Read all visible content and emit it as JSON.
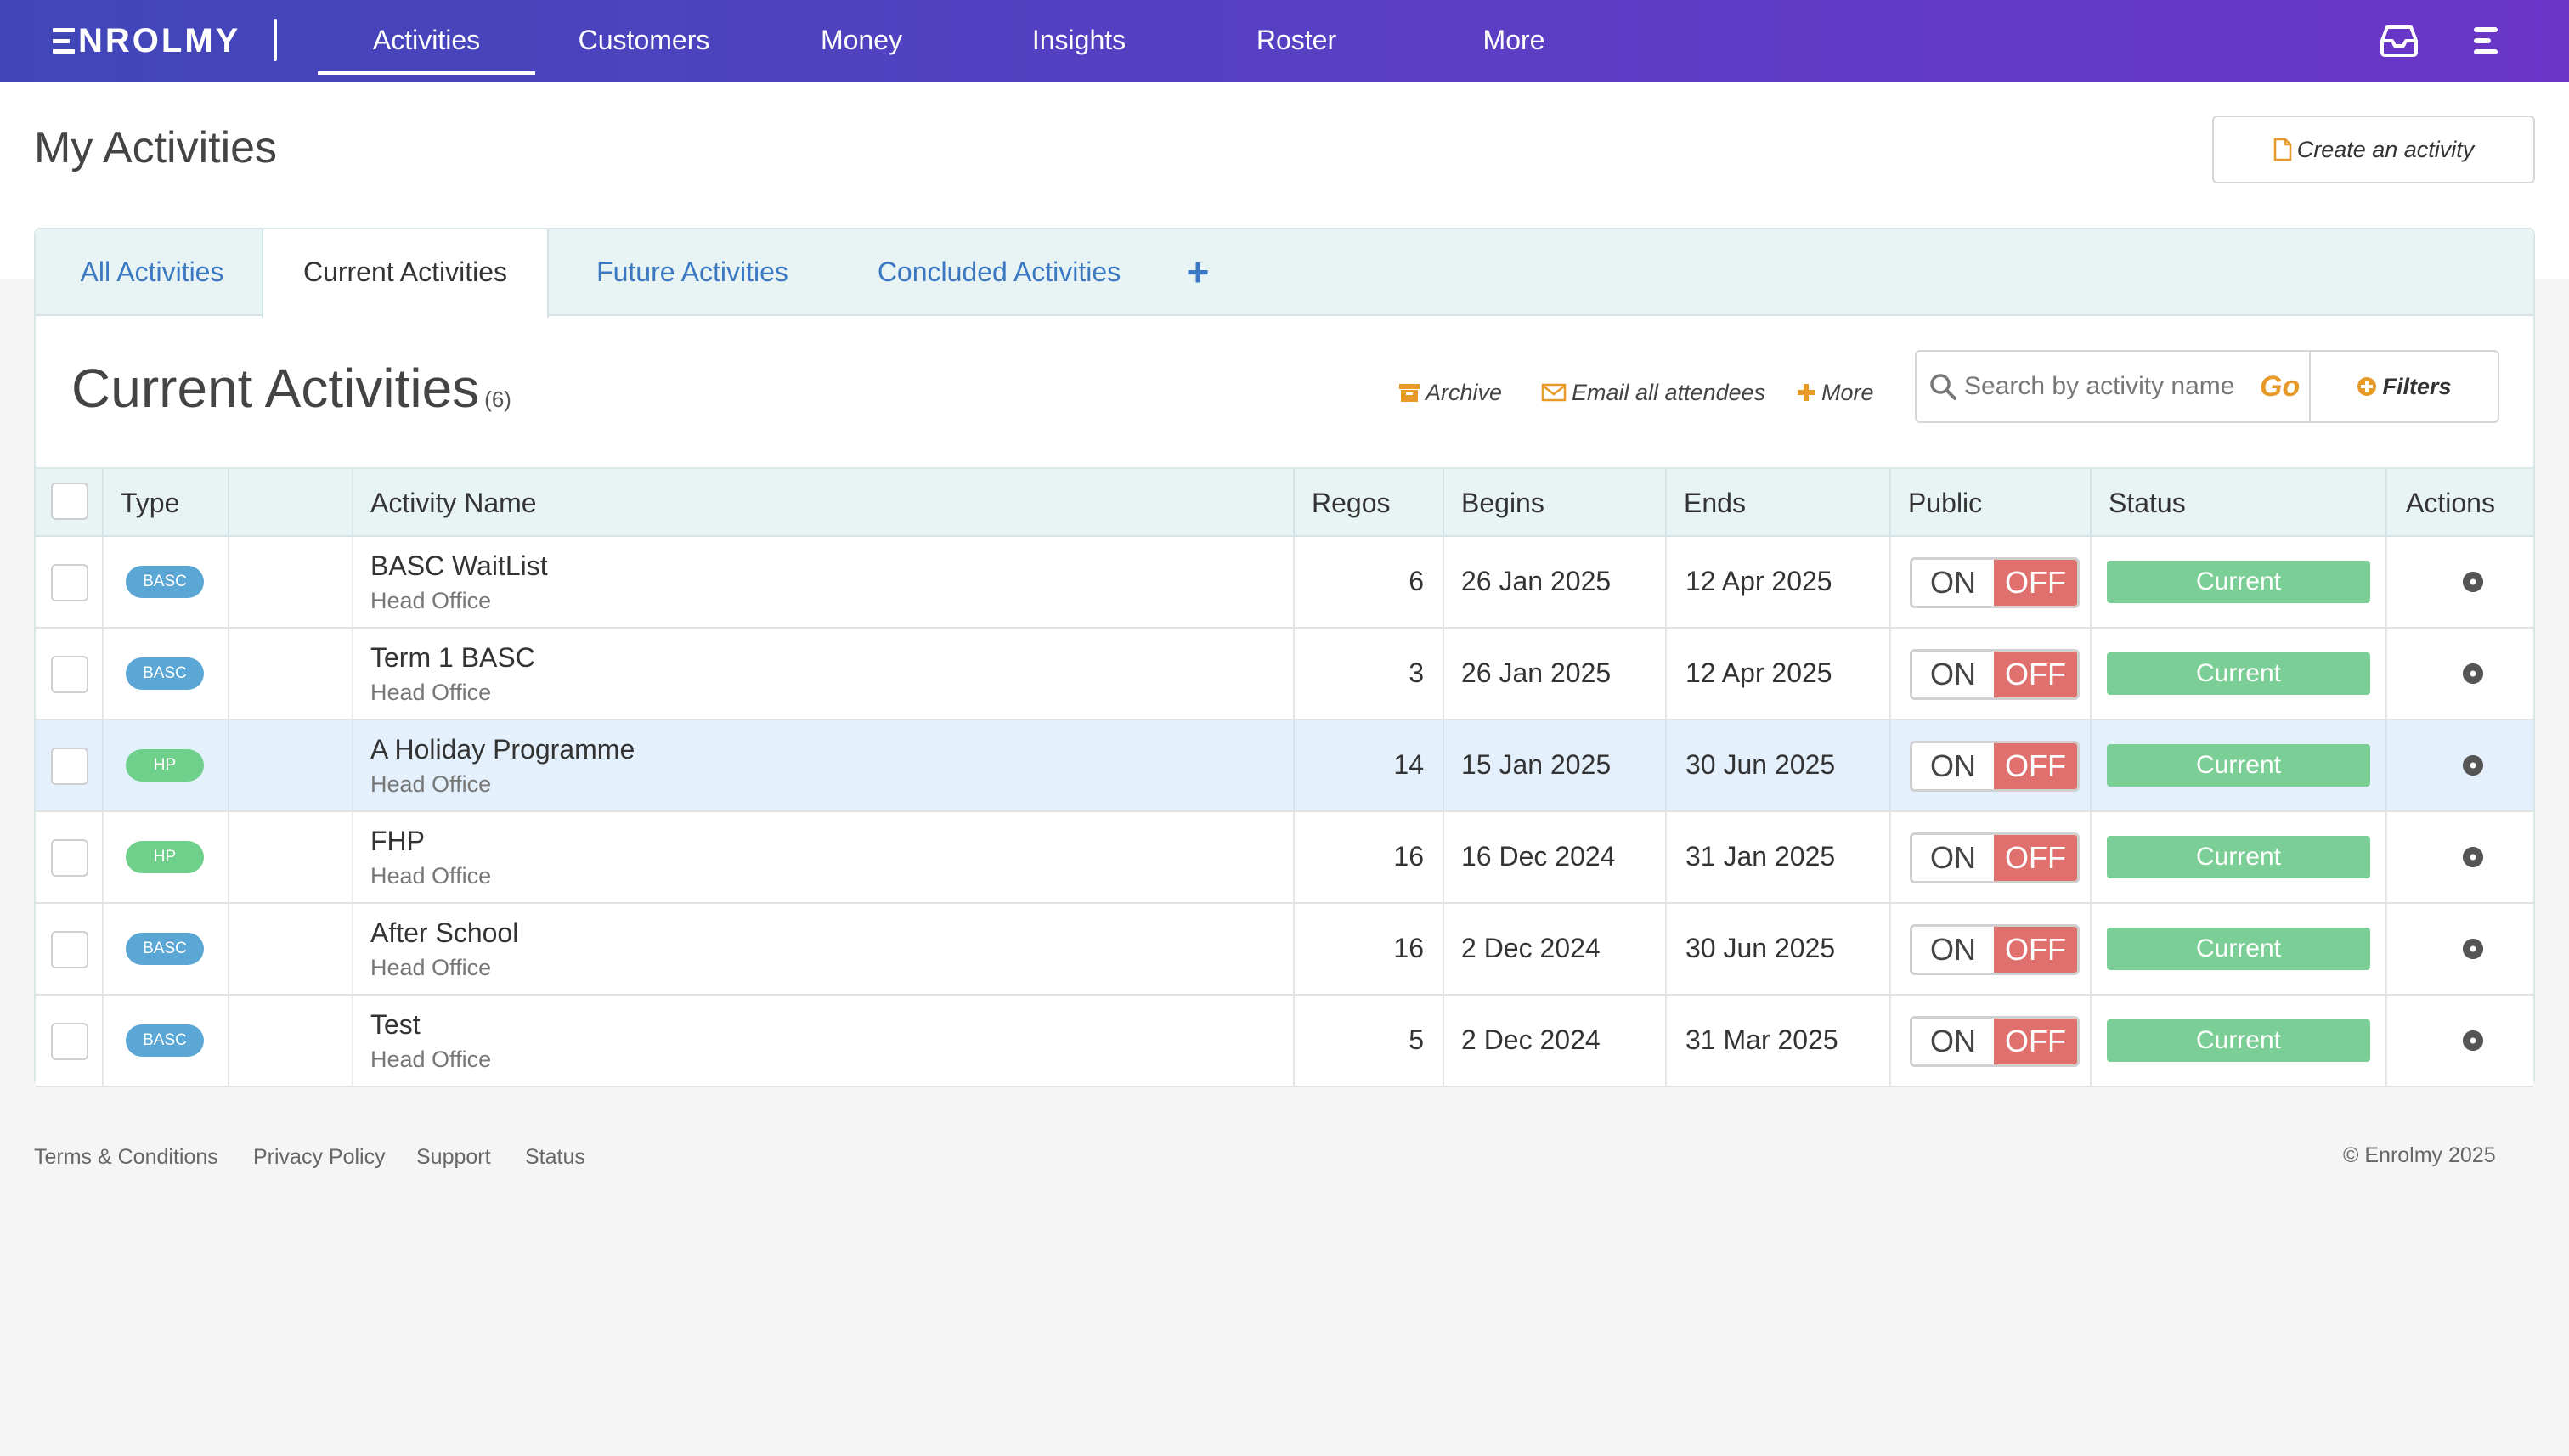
{
  "nav": {
    "logo_text": "NROLMY",
    "items": [
      {
        "label": "Activities"
      },
      {
        "label": "Customers"
      },
      {
        "label": "Money"
      },
      {
        "label": "Insights"
      },
      {
        "label": "Roster"
      },
      {
        "label": "More"
      }
    ],
    "icons": [
      "inbox-icon",
      "menu-icon"
    ]
  },
  "header": {
    "title": "My Activities",
    "create_label": "Create an activity"
  },
  "tabs": [
    {
      "label": "All Activities"
    },
    {
      "label": "Current Activities"
    },
    {
      "label": "Future Activities"
    },
    {
      "label": "Concluded Activities"
    }
  ],
  "tab_add_label": "+",
  "section": {
    "title": "Current Activities",
    "count": "(6)",
    "archive_label": "Archive",
    "email_label": "Email all attendees",
    "more_label": "More",
    "search_placeholder": "Search by activity name",
    "go_label": "Go",
    "filters_label": "Filters"
  },
  "table": {
    "headers": {
      "type": "Type",
      "name": "Activity Name",
      "regos": "Regos",
      "begins": "Begins",
      "ends": "Ends",
      "public": "Public",
      "status": "Status",
      "actions": "Actions"
    },
    "toggle_on": "ON",
    "toggle_off": "OFF",
    "rows": [
      {
        "type": "BASC",
        "name": "BASC WaitList",
        "location": "Head Office",
        "regos": "6",
        "begins": "26 Jan 2025",
        "ends": "12 Apr 2025",
        "status": "Current"
      },
      {
        "type": "BASC",
        "name": "Term 1 BASC",
        "location": "Head Office",
        "regos": "3",
        "begins": "26 Jan 2025",
        "ends": "12 Apr 2025",
        "status": "Current"
      },
      {
        "type": "HP",
        "name": "A Holiday Programme",
        "location": "Head Office",
        "regos": "14",
        "begins": "15 Jan 2025",
        "ends": "30 Jun 2025",
        "status": "Current"
      },
      {
        "type": "HP",
        "name": "FHP",
        "location": "Head Office",
        "regos": "16",
        "begins": "16 Dec 2024",
        "ends": "31 Jan 2025",
        "status": "Current"
      },
      {
        "type": "BASC",
        "name": "After School",
        "location": "Head Office",
        "regos": "16",
        "begins": "2 Dec 2024",
        "ends": "30 Jun 2025",
        "status": "Current"
      },
      {
        "type": "BASC",
        "name": "Test",
        "location": "Head Office",
        "regos": "5",
        "begins": "2 Dec 2024",
        "ends": "31 Mar 2025",
        "status": "Current"
      }
    ]
  },
  "colors": {
    "basc_pill": "#5aa7d6",
    "hp_pill": "#6fd08c",
    "status_current": "#7bcf96",
    "toggle_off": "#e0706e",
    "accent_orange": "#e89a28",
    "link_blue": "#3a78c2"
  },
  "footer": {
    "links": [
      {
        "label": "Terms & Conditions"
      },
      {
        "label": "Privacy Policy"
      },
      {
        "label": "Support"
      },
      {
        "label": "Status"
      }
    ],
    "copyright": "© Enrolmy 2025"
  }
}
